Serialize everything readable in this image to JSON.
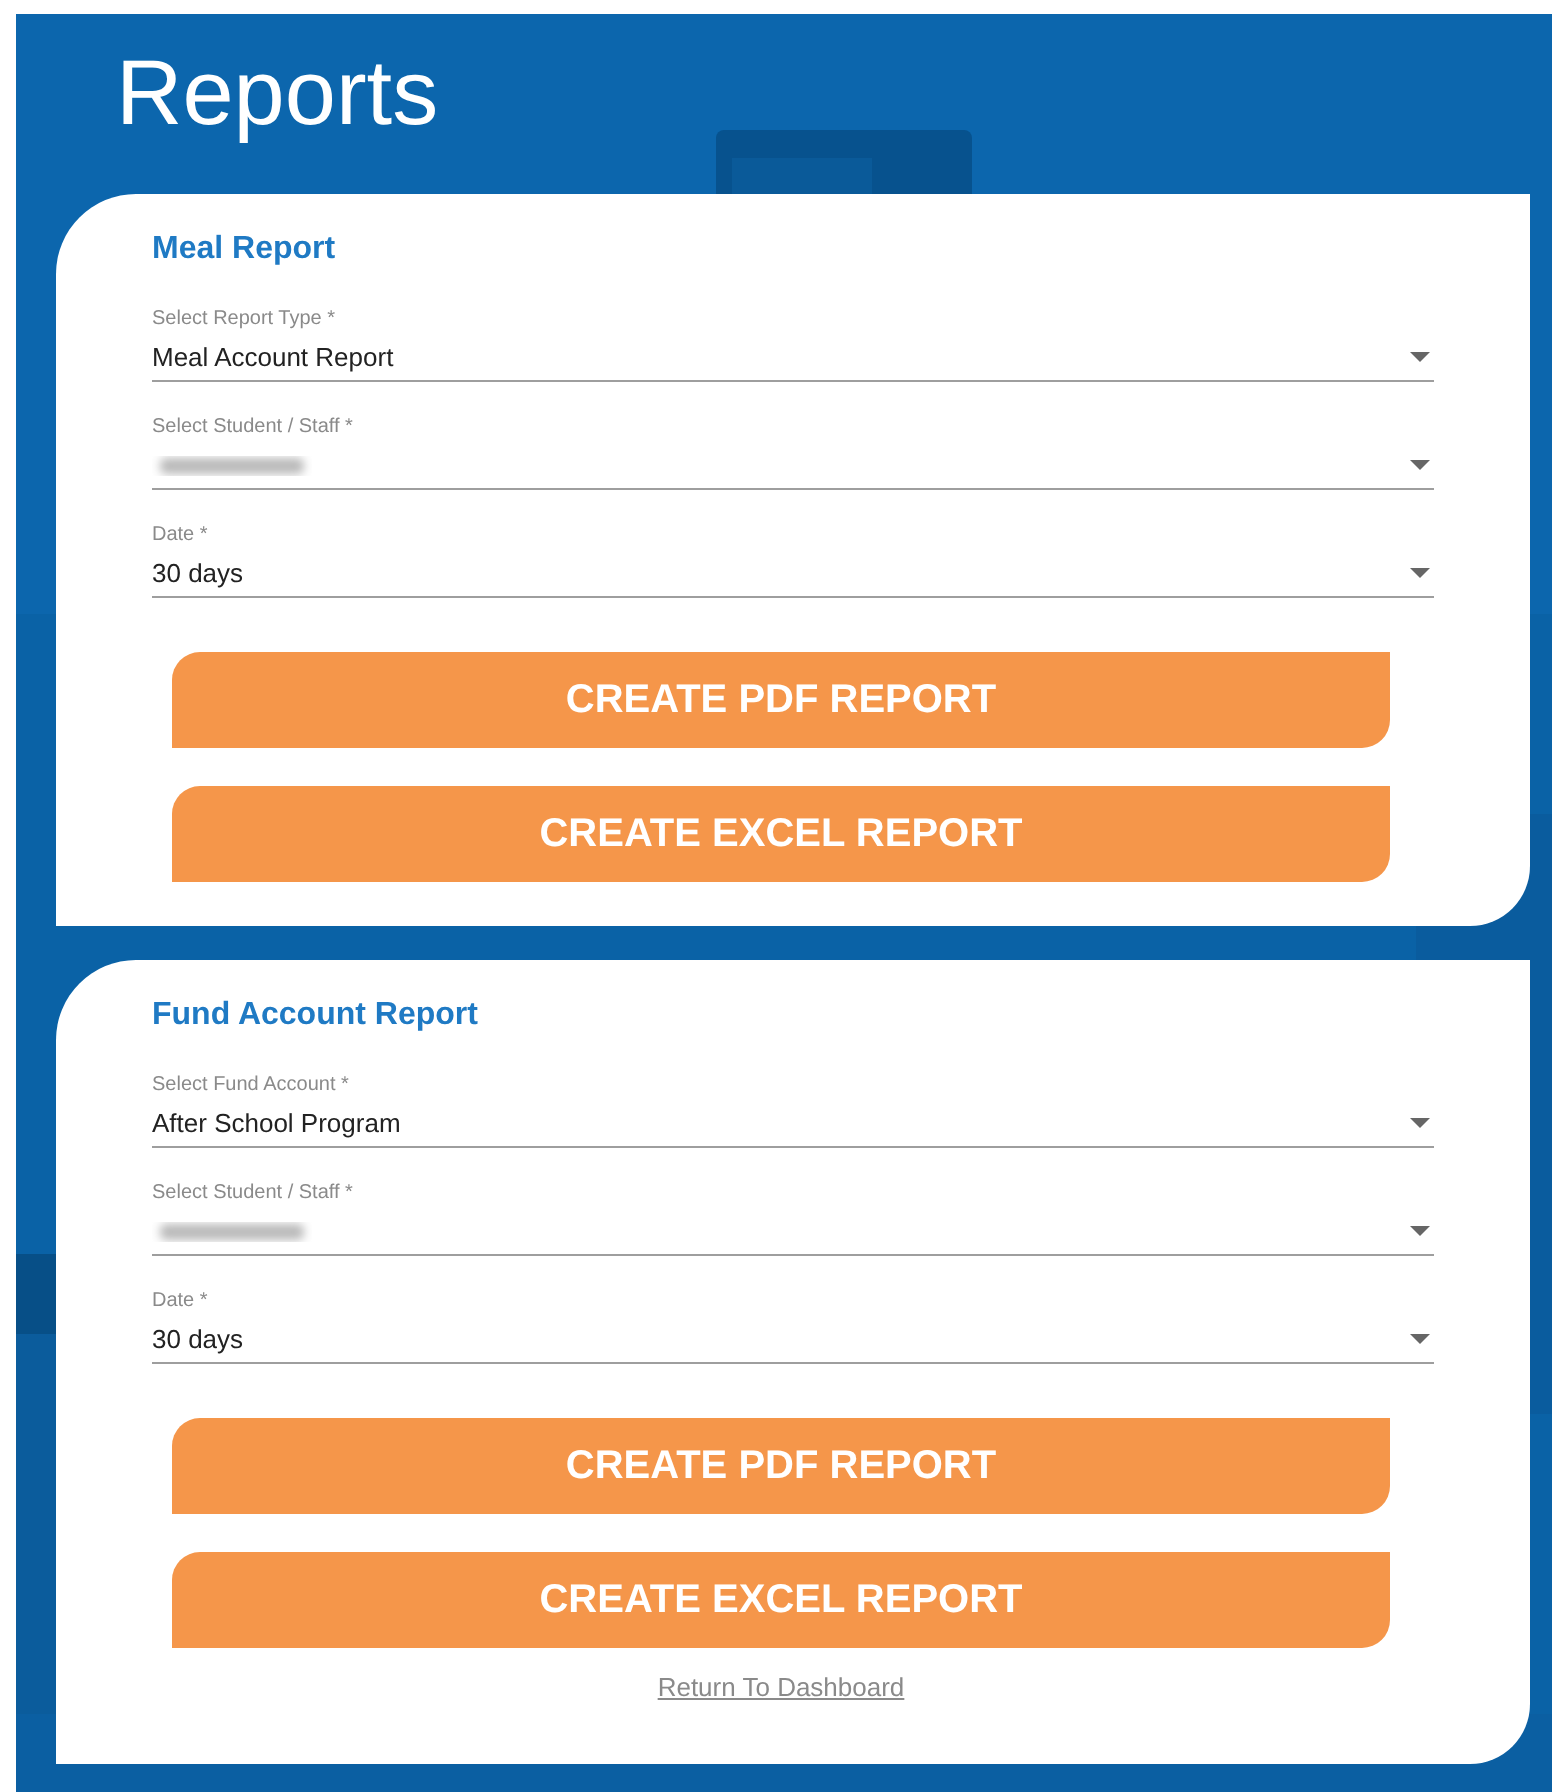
{
  "page_title": "Reports",
  "cards": [
    {
      "title": "Meal Report",
      "fields": [
        {
          "label": "Select Report Type *",
          "value": "Meal Account Report",
          "blurred": false
        },
        {
          "label": "Select Student / Staff *",
          "blurred": true
        },
        {
          "label": "Date *",
          "value": "30 days",
          "blurred": false
        }
      ],
      "buttons": [
        "CREATE PDF REPORT",
        "CREATE EXCEL REPORT"
      ]
    },
    {
      "title": "Fund Account Report",
      "fields": [
        {
          "label": "Select Fund Account *",
          "value": "After School Program",
          "blurred": false
        },
        {
          "label": "Select Student / Staff *",
          "blurred": true
        },
        {
          "label": "Date *",
          "value": "30 days",
          "blurred": false
        }
      ],
      "buttons": [
        "CREATE PDF REPORT",
        "CREATE EXCEL REPORT"
      ],
      "link": "Return To Dashboard"
    }
  ]
}
